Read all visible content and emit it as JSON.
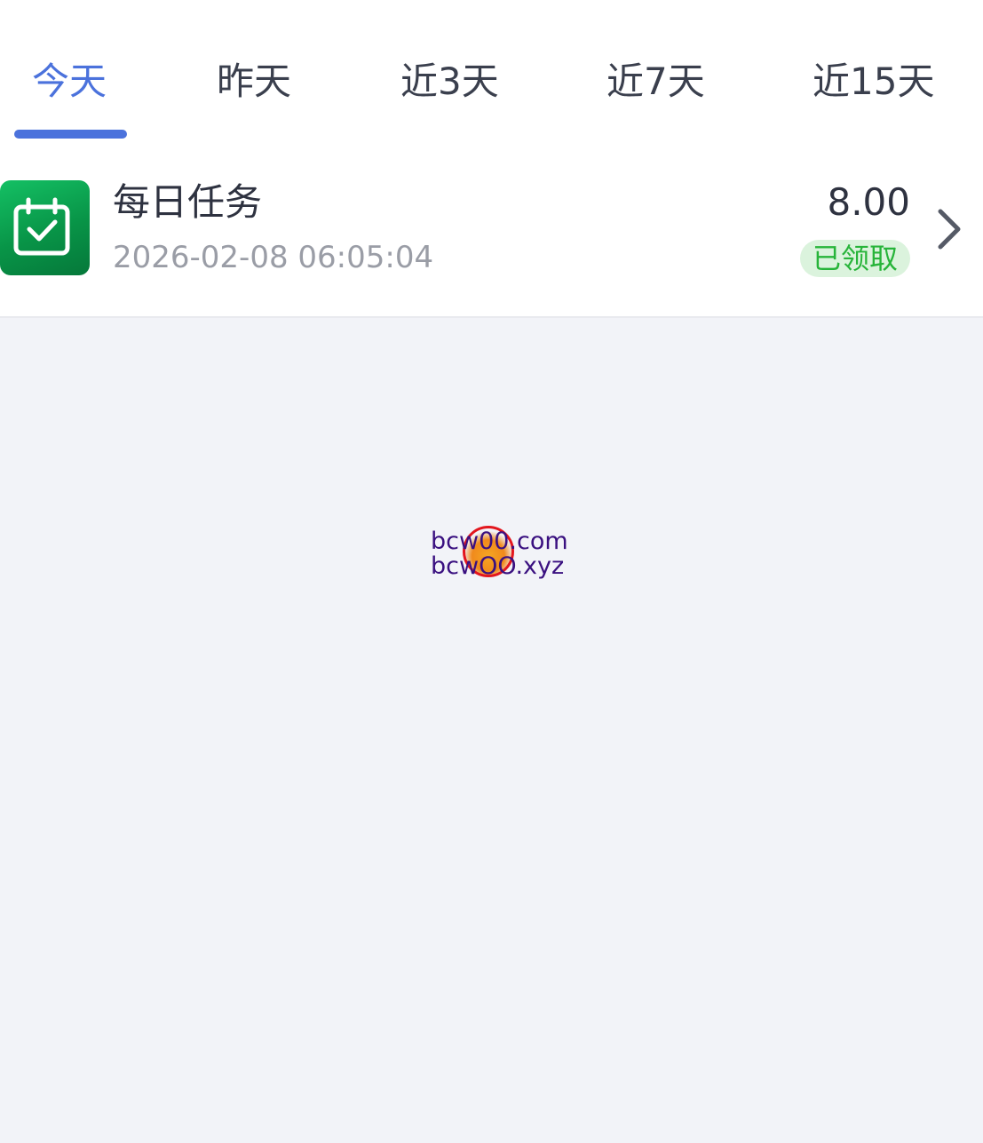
{
  "tabs": [
    {
      "label": "今天",
      "active": true
    },
    {
      "label": "昨天",
      "active": false
    },
    {
      "label": "近3天",
      "active": false
    },
    {
      "label": "近7天",
      "active": false
    },
    {
      "label": "近15天",
      "active": false
    }
  ],
  "records": [
    {
      "icon": "calendar-check-icon",
      "title": "每日任务",
      "time": "2026-02-08 06:05:04",
      "amount": "8.00",
      "status": "已领取",
      "status_color": "#27b43a"
    }
  ],
  "watermark": {
    "line1": "bcw00.com",
    "line2": "bcwOO.xyz"
  },
  "colors": {
    "accent": "#4b72dc",
    "icon_green": "#089447",
    "background": "#f2f3f8"
  }
}
